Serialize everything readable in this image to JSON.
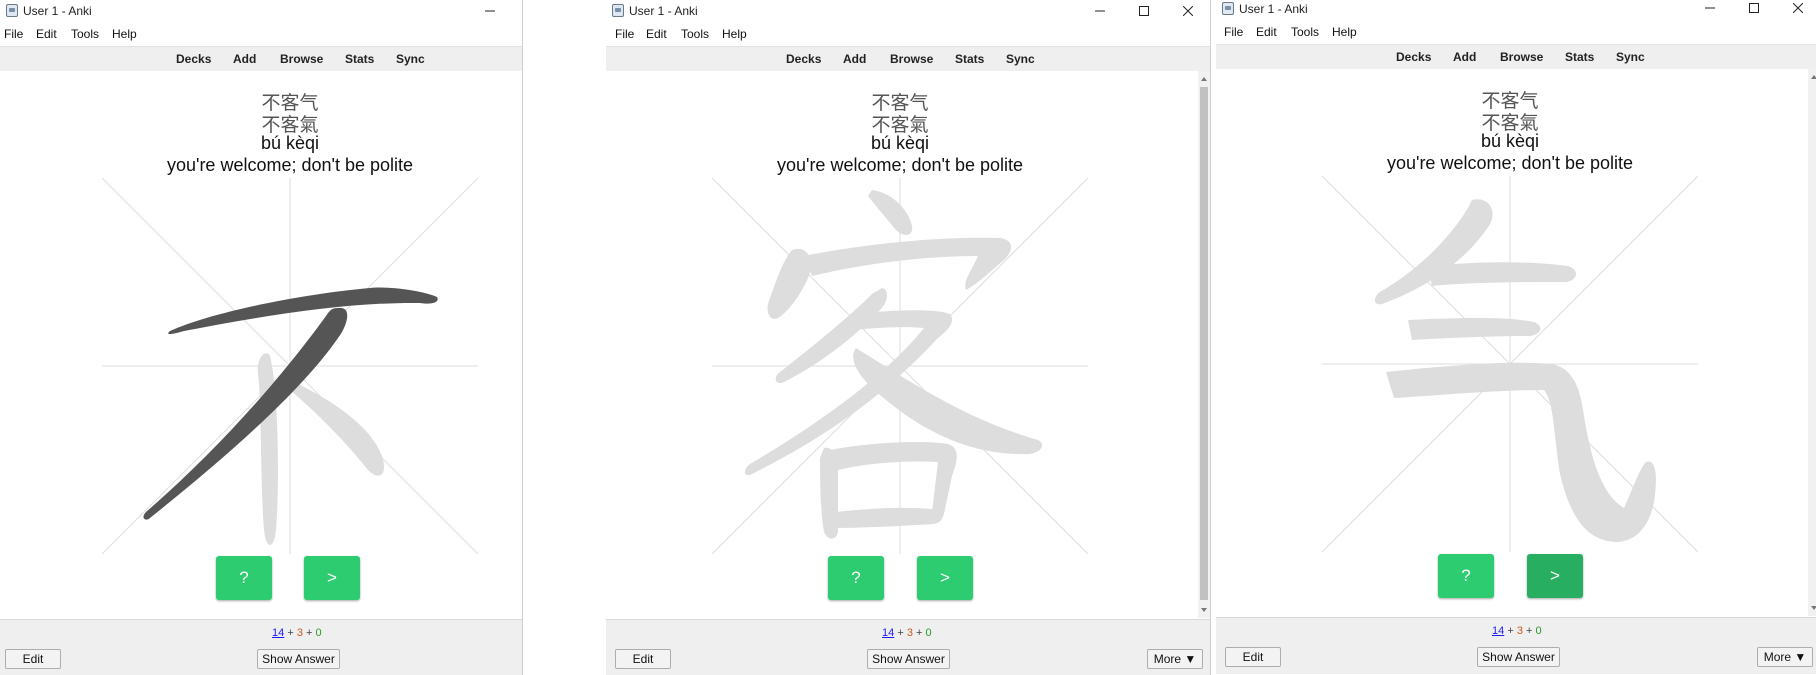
{
  "app": {
    "window_title": "User 1 - Anki",
    "menu": [
      "File",
      "Edit",
      "Tools",
      "Help"
    ],
    "toolbar": [
      "Decks",
      "Add",
      "Browse",
      "Stats",
      "Sync"
    ]
  },
  "card": {
    "simplified": "不客气",
    "traditional": "不客氣",
    "pinyin": "bú kèqi",
    "meaning": "you're welcome; don't be polite"
  },
  "windows": [
    {
      "character": "不",
      "highlighted_stroke": 2,
      "next_button_pressed": false
    },
    {
      "character": "客",
      "highlighted_stroke": 0,
      "next_button_pressed": false
    },
    {
      "character": "气",
      "highlighted_stroke": 0,
      "next_button_pressed": true
    }
  ],
  "stroke_buttons": {
    "hint": "?",
    "next": ">"
  },
  "counts": {
    "new": "14",
    "plus1": "+",
    "learn": "3",
    "plus2": "+",
    "review": "0"
  },
  "bottom": {
    "edit": "Edit",
    "show_answer": "Show Answer",
    "more": "More ▼"
  },
  "colors": {
    "green_button": "#2ecc71",
    "green_button_pressed": "#27ae60",
    "stroke_active": "#555555",
    "stroke_outline": "#dddddd",
    "new_count": "#1a1aff",
    "learn_count": "#cc5a1c",
    "review_count": "#2a9a2a"
  }
}
